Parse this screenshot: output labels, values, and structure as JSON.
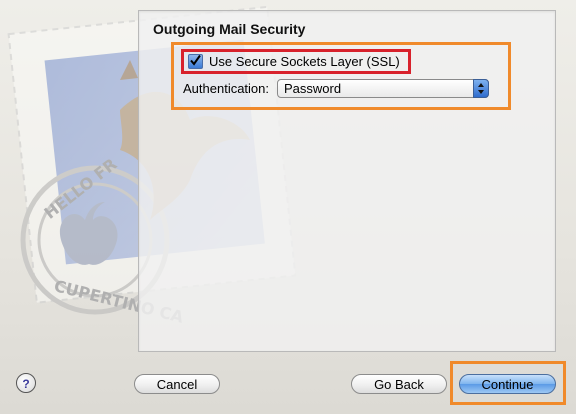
{
  "section": {
    "title": "Outgoing Mail Security"
  },
  "ssl": {
    "label": "Use Secure Sockets Layer (SSL)",
    "checked": true
  },
  "authentication": {
    "label": "Authentication:",
    "value": "Password"
  },
  "buttons": {
    "help": "?",
    "cancel": "Cancel",
    "go_back": "Go Back",
    "continue": "Continue"
  },
  "stamp": {
    "text_top": "HELLO FR",
    "text_bottom": "CUPERTINO CA"
  },
  "colors": {
    "highlight_red": "#d8222c",
    "highlight_orange": "#f08a2b",
    "accent_blue": "#3a7ad6"
  }
}
